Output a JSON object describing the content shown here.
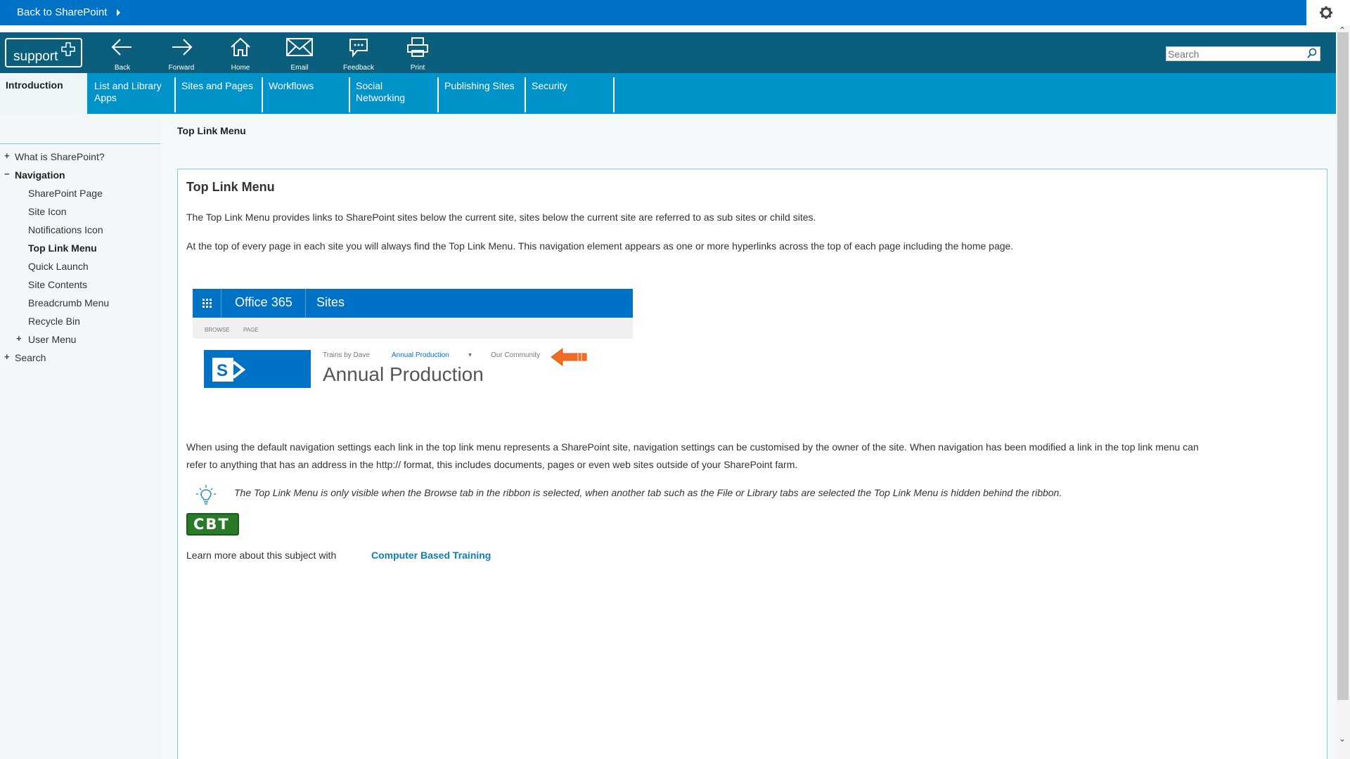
{
  "suitebar": {
    "back_label": "Back to SharePoint"
  },
  "toolbar": {
    "logo_text": "support",
    "tools": [
      {
        "label": "Back",
        "icon": "arrow-left-icon"
      },
      {
        "label": "Forward",
        "icon": "arrow-right-icon"
      },
      {
        "label": "Home",
        "icon": "home-icon"
      },
      {
        "label": "Email",
        "icon": "envelope-icon"
      },
      {
        "label": "Feedback",
        "icon": "speech-bubble-icon"
      },
      {
        "label": "Print",
        "icon": "printer-icon"
      }
    ],
    "search_placeholder": "Search"
  },
  "nav": {
    "intro": "Introduction",
    "tabs": [
      {
        "line1": "List and Library",
        "line2": "Apps"
      },
      {
        "line1": "Sites and Pages",
        "line2": ""
      },
      {
        "line1": "Workflows",
        "line2": ""
      },
      {
        "line1": "Social",
        "line2": "Networking"
      },
      {
        "line1": "Publishing Sites",
        "line2": ""
      },
      {
        "line1": "Security",
        "line2": ""
      }
    ]
  },
  "breadcrumb": "Top Link Menu",
  "tree": {
    "what_is": "What is SharePoint?",
    "navigation": "Navigation",
    "children": [
      "SharePoint Page",
      "Site Icon",
      "Notifications Icon",
      "Top Link Menu",
      "Quick Launch",
      "Site Contents",
      "Breadcrumb Menu",
      "Recycle Bin",
      "User Menu"
    ],
    "search": "Search"
  },
  "content": {
    "title": "Top Link Menu",
    "p1": "The Top Link Menu provides links to SharePoint sites below the current site, sites below the current site are referred to as sub sites or child sites.",
    "p2": "At the top of every page in each site you will always find the Top Link Menu. This navigation element appears as one or more hyperlinks across the top of each page including the home page.",
    "p3_line1": "When using the default navigation settings each link in the top link menu represents a SharePoint site, navigation settings can be customised by the owner of the site. When navigation has been modified a link in the top link menu can",
    "p3_line2": "refer to anything that has an address in the http:// format, this includes documents, pages or even web sites outside of your SharePoint farm.",
    "tip": "The Top Link Menu is only visible when the Browse tab in the ribbon is selected, when another tab such as the File or Library tabs are selected the Top Link Menu is hidden behind the ribbon.",
    "cbt_badge": "CBT",
    "learn_more": "Learn more about this subject with",
    "cbt_link": "Computer Based Training"
  },
  "screenshot": {
    "office": "Office 365",
    "sites": "Sites",
    "browse": "BROWSE",
    "page": "PAGE",
    "trains": "Trains by Dave",
    "annual_link": "Annual Production",
    "community": "Our Community",
    "big_title": "Annual Production"
  },
  "colors": {
    "suitebar": "#0072c6",
    "toolbar": "#0b5f7c",
    "navbar": "#0093c9",
    "link": "#0f7fb5"
  }
}
